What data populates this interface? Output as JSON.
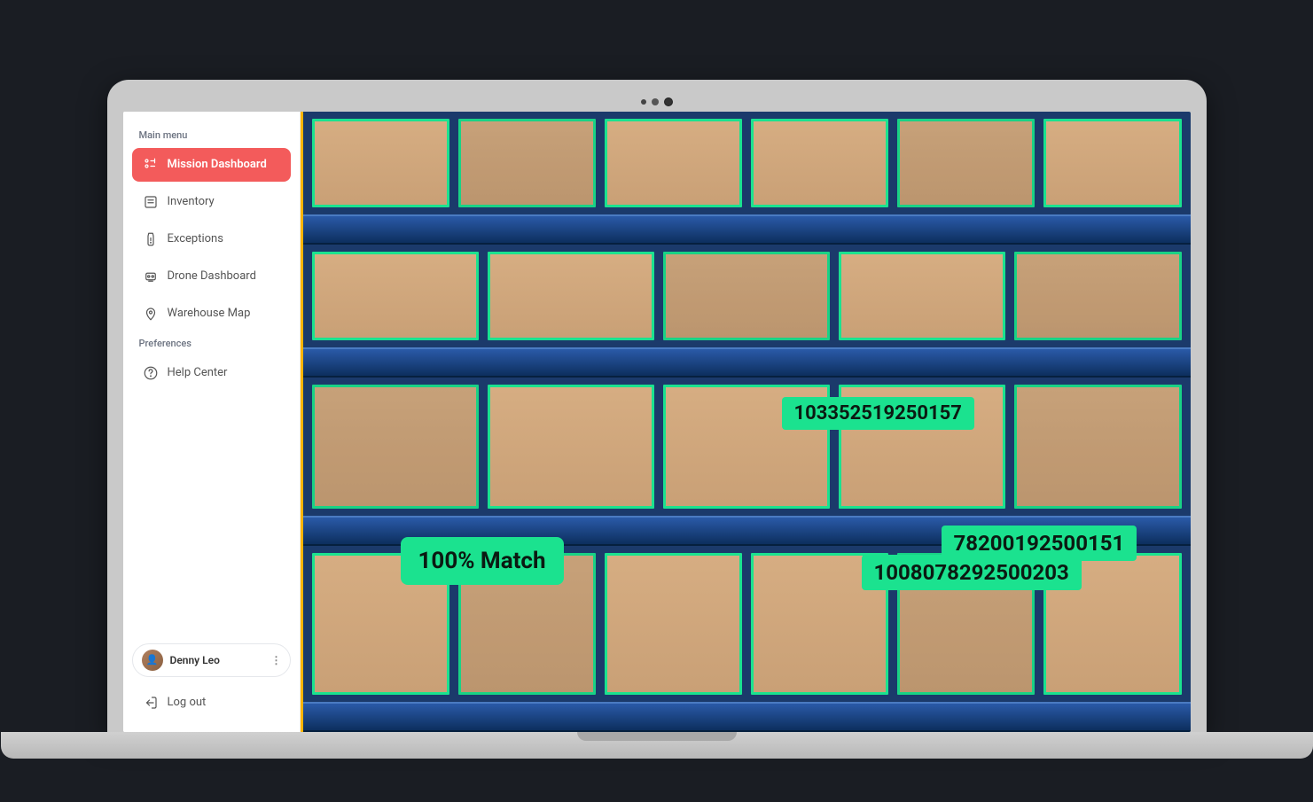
{
  "sidebar": {
    "section_main": "Main menu",
    "section_prefs": "Preferences",
    "items": [
      {
        "label": "Mission Dashboard"
      },
      {
        "label": "Inventory"
      },
      {
        "label": "Exceptions"
      },
      {
        "label": "Drone Dashboard"
      },
      {
        "label": "Warehouse Map"
      }
    ],
    "help_label": "Help Center",
    "user_name": "Denny Leo",
    "logout_label": "Log out"
  },
  "overlay": {
    "match_text": "100% Match",
    "barcode_1": "103352519250157",
    "barcode_2": "78200192500151",
    "barcode_3": "1008078292500203"
  }
}
